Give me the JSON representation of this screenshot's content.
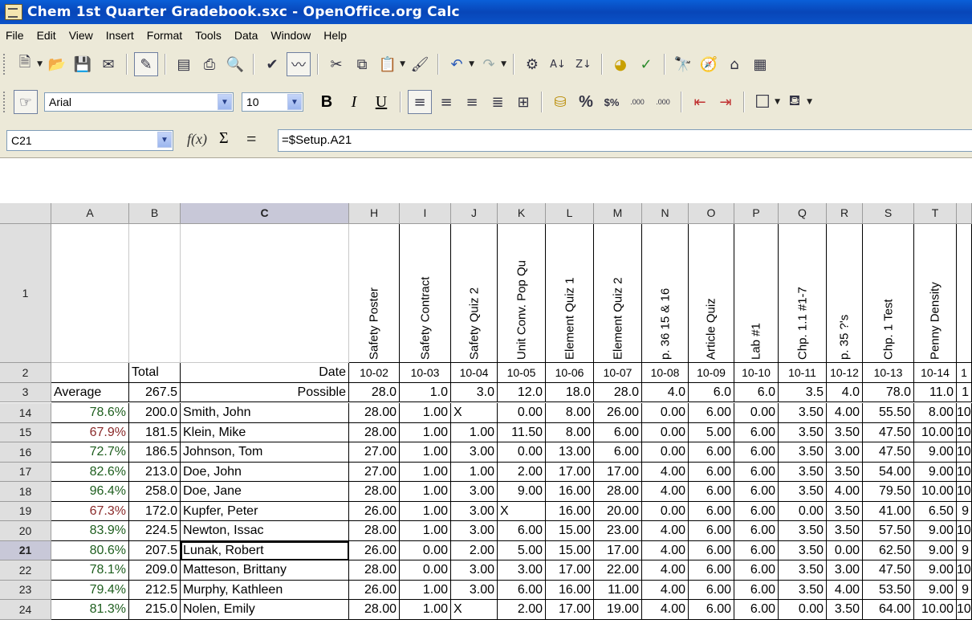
{
  "window": {
    "title": "Chem 1st Quarter Gradebook.sxc - OpenOffice.org Calc"
  },
  "menu": [
    "File",
    "Edit",
    "View",
    "Insert",
    "Format",
    "Tools",
    "Data",
    "Window",
    "Help"
  ],
  "toolbar2": {
    "font_name": "Arial",
    "font_size": "10",
    "bold": "B",
    "italic": "I",
    "underline": "U",
    "percent": "%",
    "currency": "$%",
    "add_decimal": ".000",
    "del_decimal": ".000"
  },
  "formula": {
    "cell_ref": "C21",
    "fx": "f(x)",
    "sigma": "Σ",
    "equals": "=",
    "content": "=$Setup.A21"
  },
  "columns": [
    "A",
    "B",
    "C",
    "H",
    "I",
    "J",
    "K",
    "L",
    "M",
    "N",
    "O",
    "P",
    "Q",
    "R",
    "S",
    "T",
    ""
  ],
  "headers_row1": [
    "Safety Poster",
    "Safety Contract",
    "Safety Quiz 2",
    "Unit Conv. Pop Qu",
    "Element Quiz 1",
    "Element Quiz 2",
    "p. 36 15 & 16",
    "Article Quiz",
    "Lab #1",
    "Chp. 1.1 #1-7",
    "p. 35 ?'s",
    "Chp. 1 Test",
    "Penny Density",
    ""
  ],
  "row2": {
    "num": "2",
    "a": "",
    "b": "Total",
    "c": "Date",
    "dates": [
      "10-02",
      "10-03",
      "10-04",
      "10-05",
      "10-06",
      "10-07",
      "10-08",
      "10-09",
      "10-10",
      "10-11",
      "10-12",
      "10-13",
      "10-14",
      "1"
    ]
  },
  "row3": {
    "num": "3",
    "a": "Average",
    "b": "267.5",
    "c": "Possible",
    "vals": [
      "28.0",
      "1.0",
      "3.0",
      "12.0",
      "18.0",
      "28.0",
      "4.0",
      "6.0",
      "6.0",
      "3.5",
      "4.0",
      "78.0",
      "11.0",
      "1"
    ]
  },
  "rows": [
    {
      "num": "14",
      "avg": "78.6%",
      "tone": "grn",
      "total": "200.0",
      "name": "Smith, John",
      "vals": [
        "28.00",
        "1.00",
        "X",
        "0.00",
        "8.00",
        "26.00",
        "0.00",
        "6.00",
        "0.00",
        "3.50",
        "4.00",
        "55.50",
        "8.00",
        "10"
      ]
    },
    {
      "num": "15",
      "avg": "67.9%",
      "tone": "red",
      "total": "181.5",
      "name": "Klein, Mike",
      "vals": [
        "28.00",
        "1.00",
        "1.00",
        "11.50",
        "8.00",
        "6.00",
        "0.00",
        "5.00",
        "6.00",
        "3.50",
        "3.50",
        "47.50",
        "10.00",
        "10"
      ]
    },
    {
      "num": "16",
      "avg": "72.7%",
      "tone": "grn",
      "total": "186.5",
      "name": "Johnson, Tom",
      "vals": [
        "27.00",
        "1.00",
        "3.00",
        "0.00",
        "13.00",
        "6.00",
        "0.00",
        "6.00",
        "6.00",
        "3.50",
        "3.00",
        "47.50",
        "9.00",
        "10"
      ]
    },
    {
      "num": "17",
      "avg": "82.6%",
      "tone": "grn",
      "total": "213.0",
      "name": "Doe, John",
      "vals": [
        "27.00",
        "1.00",
        "1.00",
        "2.00",
        "17.00",
        "17.00",
        "4.00",
        "6.00",
        "6.00",
        "3.50",
        "3.50",
        "54.00",
        "9.00",
        "10"
      ]
    },
    {
      "num": "18",
      "avg": "96.4%",
      "tone": "grn",
      "total": "258.0",
      "name": "Doe, Jane",
      "vals": [
        "28.00",
        "1.00",
        "3.00",
        "9.00",
        "16.00",
        "28.00",
        "4.00",
        "6.00",
        "6.00",
        "3.50",
        "4.00",
        "79.50",
        "10.00",
        "10"
      ]
    },
    {
      "num": "19",
      "avg": "67.3%",
      "tone": "red",
      "total": "172.0",
      "name": "Kupfer, Peter",
      "vals": [
        "26.00",
        "1.00",
        "3.00",
        "X",
        "16.00",
        "20.00",
        "0.00",
        "6.00",
        "6.00",
        "0.00",
        "3.50",
        "41.00",
        "6.50",
        "9"
      ]
    },
    {
      "num": "20",
      "avg": "83.9%",
      "tone": "grn",
      "total": "224.5",
      "name": "Newton, Issac",
      "vals": [
        "28.00",
        "1.00",
        "3.00",
        "6.00",
        "15.00",
        "23.00",
        "4.00",
        "6.00",
        "6.00",
        "3.50",
        "3.50",
        "57.50",
        "9.00",
        "10"
      ]
    },
    {
      "num": "21",
      "avg": "80.6%",
      "tone": "grn",
      "total": "207.5",
      "name": "Lunak, Robert",
      "vals": [
        "26.00",
        "0.00",
        "2.00",
        "5.00",
        "15.00",
        "17.00",
        "4.00",
        "6.00",
        "6.00",
        "3.50",
        "0.00",
        "62.50",
        "9.00",
        "9"
      ]
    },
    {
      "num": "22",
      "avg": "78.1%",
      "tone": "grn",
      "total": "209.0",
      "name": "Matteson, Brittany",
      "vals": [
        "28.00",
        "0.00",
        "3.00",
        "3.00",
        "17.00",
        "22.00",
        "4.00",
        "6.00",
        "6.00",
        "3.50",
        "3.00",
        "47.50",
        "9.00",
        "10"
      ]
    },
    {
      "num": "23",
      "avg": "79.4%",
      "tone": "grn",
      "total": "212.5",
      "name": "Murphy, Kathleen",
      "vals": [
        "26.00",
        "1.00",
        "3.00",
        "6.00",
        "16.00",
        "11.00",
        "4.00",
        "6.00",
        "6.00",
        "3.50",
        "4.00",
        "53.50",
        "9.00",
        "9"
      ]
    },
    {
      "num": "24",
      "avg": "81.3%",
      "tone": "grn",
      "total": "215.0",
      "name": "Nolen, Emily",
      "vals": [
        "28.00",
        "1.00",
        "X",
        "2.00",
        "17.00",
        "19.00",
        "4.00",
        "6.00",
        "6.00",
        "0.00",
        "3.50",
        "64.00",
        "10.00",
        "10"
      ]
    }
  ],
  "selected_cell": "C21"
}
